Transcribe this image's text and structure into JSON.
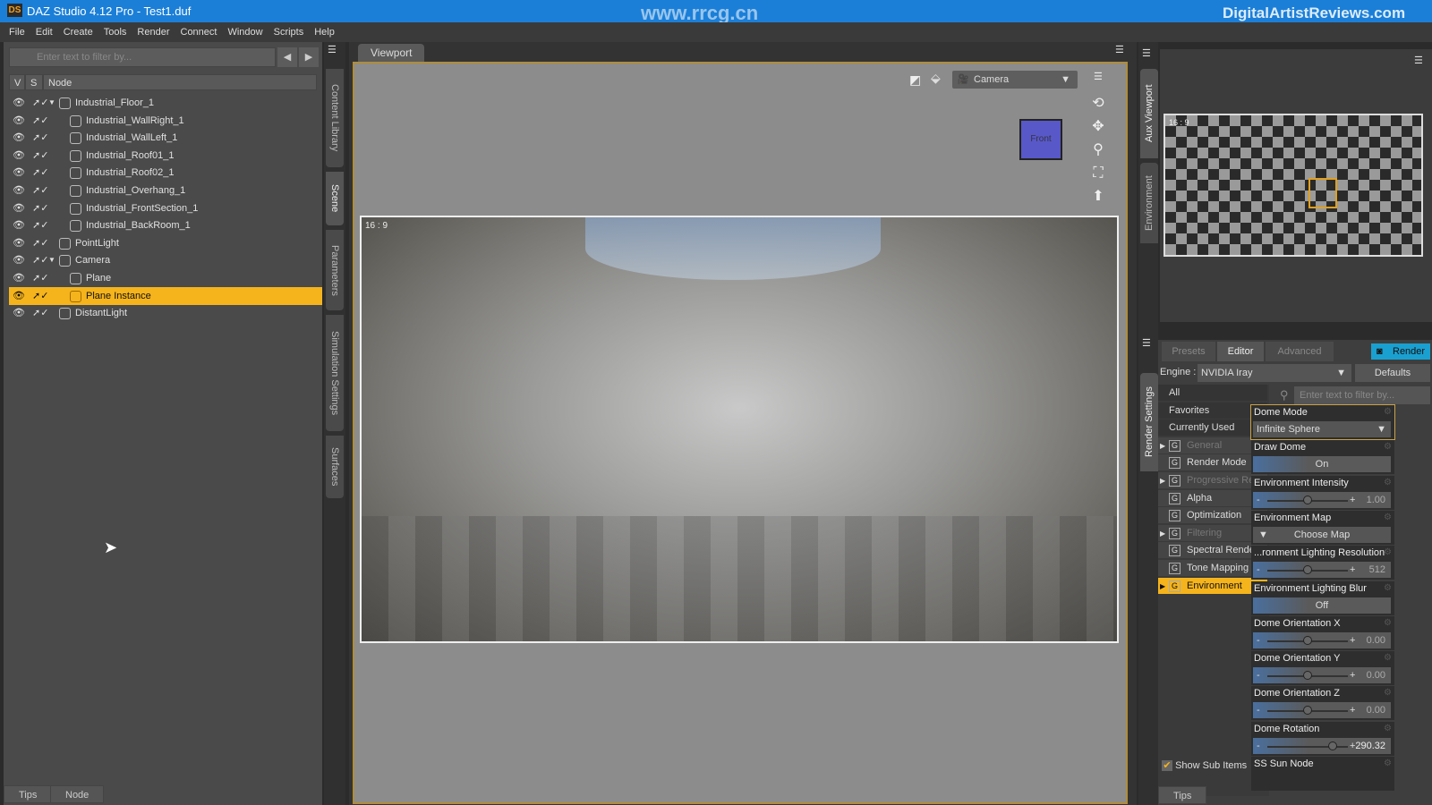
{
  "titlebar": {
    "title": "DAZ Studio 4.12 Pro - Test1.duf",
    "logo": "DS",
    "watermark_center": "www.rrcg.cn",
    "watermark_right": "DigitalArtistReviews.com"
  },
  "menu": [
    "File",
    "Edit",
    "Create",
    "Tools",
    "Render",
    "Connect",
    "Window",
    "Scripts",
    "Help"
  ],
  "scene": {
    "filter_placeholder": "Enter text to filter by...",
    "col_v": "V",
    "col_s": "S",
    "col_node": "Node",
    "nodes": [
      {
        "label": "Industrial_Floor_1",
        "depth": 0,
        "expand": "open",
        "icon": "mesh"
      },
      {
        "label": "Industrial_WallRight_1",
        "depth": 1,
        "icon": "mesh"
      },
      {
        "label": "Industrial_WallLeft_1",
        "depth": 1,
        "icon": "mesh"
      },
      {
        "label": "Industrial_Roof01_1",
        "depth": 1,
        "icon": "mesh"
      },
      {
        "label": "Industrial_Roof02_1",
        "depth": 1,
        "icon": "mesh"
      },
      {
        "label": "Industrial_Overhang_1",
        "depth": 1,
        "icon": "mesh"
      },
      {
        "label": "Industrial_FrontSection_1",
        "depth": 1,
        "icon": "mesh"
      },
      {
        "label": "Industrial_BackRoom_1",
        "depth": 1,
        "icon": "mesh"
      },
      {
        "label": "PointLight",
        "depth": 0,
        "icon": "point-light"
      },
      {
        "label": "Camera",
        "depth": 0,
        "expand": "open",
        "icon": "camera"
      },
      {
        "label": "Plane",
        "depth": 1,
        "icon": "mesh"
      },
      {
        "label": "Plane Instance",
        "depth": 1,
        "icon": "instance",
        "selected": true
      },
      {
        "label": "DistantLight",
        "depth": 0,
        "icon": "distant-light"
      }
    ],
    "bottom_tabs": [
      "Tips",
      "Node"
    ]
  },
  "side_tabs": [
    "Content Library",
    "Scene",
    "Parameters",
    "Simulation Settings",
    "Surfaces"
  ],
  "viewport": {
    "tab": "Viewport",
    "camera": "Camera",
    "aspect": "16 : 9",
    "cube_label": "Front"
  },
  "right_tabs": [
    "Aux Viewport",
    "Environment",
    "Render Settings"
  ],
  "aux": {
    "aspect": "16 : 9"
  },
  "render_settings": {
    "tabs": [
      "Presets",
      "Editor",
      "Advanced"
    ],
    "active_tab": "Editor",
    "render_button": "Render",
    "engine_label": "Engine :",
    "engine": "NVIDIA Iray",
    "defaults": "Defaults",
    "filter_placeholder": "Enter text to filter by...",
    "categories": [
      {
        "label": "All"
      },
      {
        "label": "Favorites"
      },
      {
        "label": "Currently Used"
      },
      {
        "label": "General",
        "group": true,
        "expand": true,
        "dim": true
      },
      {
        "label": "Render Mode",
        "group": true
      },
      {
        "label": "Progressive Re...",
        "group": true,
        "expand": true,
        "dim": true
      },
      {
        "label": "Alpha",
        "group": true
      },
      {
        "label": "Optimization",
        "group": true
      },
      {
        "label": "Filtering",
        "group": true,
        "expand": true,
        "dim": true
      },
      {
        "label": "Spectral Rende...",
        "group": true
      },
      {
        "label": "Tone Mapping",
        "group": true
      },
      {
        "label": "Environment",
        "group": true,
        "expand": true,
        "selected": true
      }
    ],
    "show_sub_items": "Show Sub Items",
    "show_sub_items_checked": true,
    "properties": [
      {
        "label": "Dome Mode",
        "type": "select",
        "value": "Infinite Sphere"
      },
      {
        "label": "Draw Dome",
        "type": "toggle",
        "value": "On"
      },
      {
        "label": "Environment Intensity",
        "type": "slider",
        "value": "1.00",
        "fraction": 0.5
      },
      {
        "label": "Environment Map",
        "type": "map",
        "value": "Choose Map"
      },
      {
        "label": "...ronment Lighting Resolution",
        "type": "slider",
        "value": "512",
        "fraction": 0.5
      },
      {
        "label": "Environment Lighting Blur",
        "type": "toggle",
        "value": "Off"
      },
      {
        "label": "Dome Orientation X",
        "type": "slider",
        "value": "0.00",
        "fraction": 0.5
      },
      {
        "label": "Dome Orientation Y",
        "type": "slider",
        "value": "0.00",
        "fraction": 0.5
      },
      {
        "label": "Dome Orientation Z",
        "type": "slider",
        "value": "0.00",
        "fraction": 0.5
      },
      {
        "label": "Dome Rotation",
        "type": "slider",
        "value": "290.32",
        "fraction": 0.81
      },
      {
        "label": "SS Sun Node",
        "type": "header"
      }
    ],
    "bottom_tab": "Tips"
  },
  "colors": {
    "accent": "#f5b41c",
    "titlebar": "#1b7fd8",
    "render_button": "#1aa0d0"
  }
}
